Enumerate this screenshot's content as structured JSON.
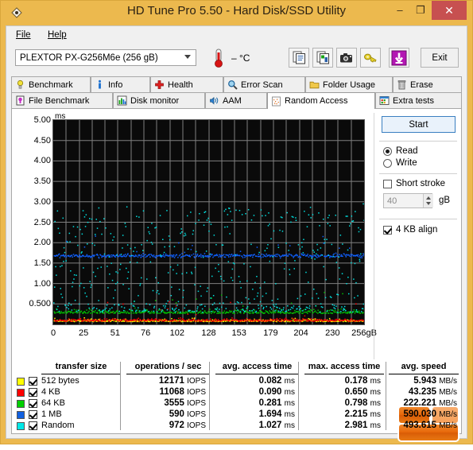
{
  "window": {
    "title": "HD Tune Pro 5.50 - Hard Disk/SSD Utility",
    "minimize": "–",
    "maximize": "❐",
    "close": "✕"
  },
  "menubar": {
    "file": "File",
    "help": "Help"
  },
  "toolbar": {
    "drive": "PLEXTOR PX-G256M6e (256 gB)",
    "temperature": "– °C",
    "exit": "Exit",
    "buttons": [
      "copy-icon",
      "copy-image-icon",
      "camera-icon",
      "folder-key-icon",
      "download-icon"
    ]
  },
  "tabs": {
    "row1": [
      {
        "label": "Benchmark",
        "icon": "lightbulb-icon",
        "selected": false
      },
      {
        "label": "Info",
        "icon": "info-icon",
        "selected": false
      },
      {
        "label": "Health",
        "icon": "health-cross-icon",
        "selected": false
      },
      {
        "label": "Error Scan",
        "icon": "magnifier-icon",
        "selected": false
      },
      {
        "label": "Folder Usage",
        "icon": "folder-icon",
        "selected": false
      },
      {
        "label": "Erase",
        "icon": "trash-icon",
        "selected": false
      }
    ],
    "row2": [
      {
        "label": "File Benchmark",
        "icon": "file-benchmark-icon",
        "selected": false
      },
      {
        "label": "Disk monitor",
        "icon": "bar-chart-icon",
        "selected": false
      },
      {
        "label": "AAM",
        "icon": "speaker-icon",
        "selected": false
      },
      {
        "label": "Random Access",
        "icon": "scatter-icon",
        "selected": true
      },
      {
        "label": "Extra tests",
        "icon": "extra-tests-icon",
        "selected": false
      }
    ]
  },
  "controls": {
    "start": "Start",
    "mode_read": "Read",
    "mode_write": "Write",
    "mode_selected": "Read",
    "short_stroke_label": "Short stroke",
    "short_stroke_checked": false,
    "short_stroke_value": "40",
    "short_stroke_unit": "gB",
    "align_label": "4 KB align",
    "align_checked": true
  },
  "chart_data": {
    "type": "scatter",
    "title": "",
    "xlabel": "",
    "ylabel": "ms",
    "yunit": "ms",
    "xunit": "gB",
    "ylim": [
      0,
      5.0
    ],
    "xlim": [
      0,
      256
    ],
    "ytick_labels": [
      "5.00",
      "4.50",
      "4.00",
      "3.50",
      "3.00",
      "2.50",
      "2.00",
      "1.50",
      "1.00",
      "0.500"
    ],
    "ytick_values": [
      5.0,
      4.5,
      4.0,
      3.5,
      3.0,
      2.5,
      2.0,
      1.5,
      1.0,
      0.5
    ],
    "xtick_labels": [
      "0",
      "25",
      "51",
      "76",
      "102",
      "128",
      "153",
      "179",
      "204",
      "230",
      "256gB"
    ],
    "xtick_values": [
      0,
      25,
      51,
      76,
      102,
      128,
      153,
      179,
      204,
      230,
      256
    ],
    "grid": true,
    "background": "#0a0a0a",
    "gridcolor": "#808080",
    "legend_position": "below-table",
    "series": [
      {
        "name": "512 bytes",
        "color": "#ffff00",
        "mean_ms": 0.082,
        "max_ms": 0.178,
        "spread": 0.05,
        "points": 420
      },
      {
        "name": "4 KB",
        "color": "#ff0000",
        "mean_ms": 0.09,
        "max_ms": 0.65,
        "spread": 0.07,
        "points": 420
      },
      {
        "name": "64 KB",
        "color": "#00c000",
        "mean_ms": 0.281,
        "max_ms": 0.798,
        "spread": 0.1,
        "points": 420
      },
      {
        "name": "1 MB",
        "color": "#1060ff",
        "mean_ms": 1.694,
        "max_ms": 2.215,
        "spread": 0.09,
        "points": 420
      },
      {
        "name": "Random",
        "color": "#00e0e0",
        "mean_ms": 1.027,
        "max_ms": 2.981,
        "spread": 0.75,
        "points": 560
      }
    ]
  },
  "results": {
    "headers": [
      "transfer size",
      "operations / sec",
      "avg. access time",
      "max. access time",
      "avg. speed"
    ],
    "rows": [
      {
        "color": "#ffff00",
        "checked": true,
        "size": "512 bytes",
        "iops": "12171 IOPS",
        "avg_access": "0.082 ms",
        "max_access": "0.178 ms",
        "avg_speed": "5.943 MB/s"
      },
      {
        "color": "#ff0000",
        "checked": true,
        "size": "4 KB",
        "iops": "11068 IOPS",
        "avg_access": "0.090 ms",
        "max_access": "0.650 ms",
        "avg_speed": "43.235 MB/s"
      },
      {
        "color": "#00d000",
        "checked": true,
        "size": "64 KB",
        "iops": "3555 IOPS",
        "avg_access": "0.281 ms",
        "max_access": "0.798 ms",
        "avg_speed": "222.221 MB/s"
      },
      {
        "color": "#1060e0",
        "checked": true,
        "size": "1 MB",
        "iops": "590 IOPS",
        "avg_access": "1.694 ms",
        "max_access": "2.215 ms",
        "avg_speed": "590.030 MB/s"
      },
      {
        "color": "#00e8e8",
        "checked": true,
        "size": "Random",
        "iops": "972 IOPS",
        "avg_access": "1.027 ms",
        "max_access": "2.981 ms",
        "avg_speed": "493.615 MB/s"
      }
    ]
  },
  "theme": {
    "titlebar": "#ecb94e",
    "close": "#c75050",
    "accent": "#3a7fc1",
    "watermark": "#e8690b"
  }
}
